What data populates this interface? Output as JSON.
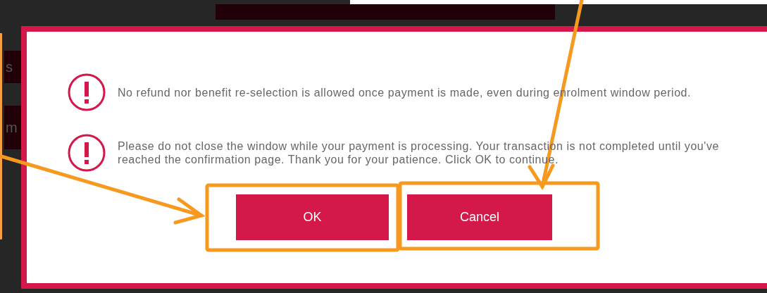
{
  "background": {
    "fragments": [
      "s",
      "m"
    ]
  },
  "dialog": {
    "messages": [
      {
        "text": "No refund nor benefit re-selection is allowed once payment is made, even during enrolment window period."
      },
      {
        "text": "Please do not close the window while your payment is processing. Your transaction is not completed until you've reached the confirmation page. Thank you for your patience. Click OK to continue."
      }
    ],
    "buttons": [
      {
        "label": "OK"
      },
      {
        "label": "Cancel"
      }
    ]
  }
}
